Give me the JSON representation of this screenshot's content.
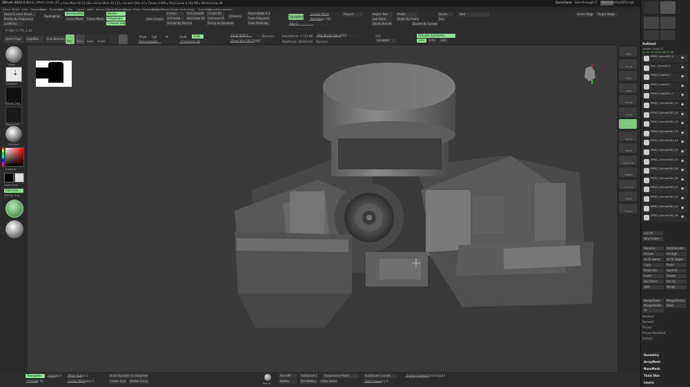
{
  "app": {
    "title": "ZBrush 2022.0.1",
    "file": "Ionic_Mech_tools_02",
    "stats": "▸ Free Mem 92.23 GB ▸ Active Mem 20.135 ▸ Scratch Disk 47 ▸ Timer▸ 0.009 ▸ PolyCount▸ 6.742 MP ▸ MeshCount▸ 48",
    "quicksave": "QuickSave",
    "see_through": "See-through 0",
    "menus_label": "Menus",
    "script": "DefaultZScript"
  },
  "menu": [
    "Alpha",
    "Brush",
    "Color",
    "Document",
    "Draw",
    "Dynamics",
    "Edit",
    "File",
    "Layer",
    "Light",
    "Macro",
    "Marker",
    "Material",
    "Movie",
    "Picker",
    "Preferences",
    "Render",
    "Stencil",
    "Stroke",
    "Texture",
    "Tool",
    "Transform",
    "Zplugin",
    "Zscript",
    "Help"
  ],
  "toptool": {
    "reset": "Reset Current Brush",
    "draft": "Draft By Floor",
    "modify": "Modify By Frequency 6",
    "list": "ListMirror",
    "topological": "Topological",
    "gizmo_mode": "Gizmo Mode",
    "backfacemask": "BackfaceMask",
    "curve_mode": "Curve Mode",
    "frame_mesh": "Frame Mesh",
    "border": "Border",
    "polygroups": "Polygroups",
    "creased_edges": "Creased edges",
    "crease": "Crease",
    "uncrease": "UnCrease",
    "uncrease_all": "UnCreaseAll",
    "crease_pg": "Crease PG",
    "uncrease_pg": "UnCrease PG",
    "groups_normals": "Groups By Normals",
    "create_pg": "Create PG",
    "crease_lvl": "Crease Lvl",
    "auto_groups": "Auto Groups",
    "group": "Group",
    "merge_groups": "Merge Groups",
    "group_split": "Group As Dynamesh Sub",
    "from_polypaint": "From Polypaint",
    "from_masking": "From Masking",
    "resolution": "Resol Width 0.32",
    "dynamesh": "DynaMesh",
    "groups_polish": "Groups  Polish",
    "project": "Project",
    "resolution2": "Resolution 256",
    "blur": "Blur 2",
    "smooth": "Higher Res",
    "sub_ratio": "Sub Ratio",
    "polish": "Polish",
    "polish_by_features": "Polish By Features",
    "shrink": "Shrink Prot Mirror",
    "double": "Double By Symmetry",
    "divide": "Divide",
    "smt": "Smt",
    "suv": "Suv",
    "rgb": "Rgb",
    "size": "Size",
    "home": "Home Stage",
    "target": "Target Stage",
    "coords": "0.7847,0.776,-1.2X",
    "home_page": "Home Page",
    "lightbox": "LightBox",
    "live_boolean": "Live Boolean",
    "edit": "Edit",
    "move": "Move",
    "scale": "Scale",
    "rotate": "Rotate",
    "mrgb": "Mrgb",
    "rgb2": "Rgb",
    "m": "M",
    "zadd": "Zadd",
    "zsub": "Zsub",
    "z_intensity": "Z Intensity 40",
    "rgb_intensity": "Rgb Intensity",
    "focal_shift": "Focal Shift 0",
    "draw_size": "Draw Size 102.21887",
    "dynamic": "Dynamic",
    "active_points": "ActivePoints: 4.723 Mil",
    "total_points": "TotalPoints: 18.943 Mil",
    "max_size": "Max Brush Size 4403",
    "dynamic2": "Dynamic",
    "xyz": "XYZ",
    "constant": "Constant",
    "activate_symmetry": "Activate Symmetry",
    "x": ">X<",
    "y": ">Y<",
    "z": ">Z<"
  },
  "left": {
    "alpha": "Alpha Off",
    "texture": "Texture Off",
    "material": "MatCap Gray",
    "gradient": "Gradient",
    "switch_color": "SwitchColor",
    "alternate": "Alternate",
    "brush": "Move",
    "stroke": "DragRect",
    "tool": "ZBrush_Ray",
    "color_label": "FillObject"
  },
  "right_shelf": [
    "Best",
    "Persp",
    "Floor",
    "Local",
    "Transp",
    "Ghost",
    "Solo",
    "Xpose",
    "Move",
    "Zoom3D",
    "Rotate",
    "Line Fill",
    "PolyF",
    "Frame"
  ],
  "tray": {
    "header_tools": [
      "PM3D_Cylinder3D",
      "FillObject",
      "SimpleBrush",
      "EraserBrush",
      "PM3D_Cyl...",
      "ZSphere",
      "Bananas"
    ],
    "subtool_title": "Subtool",
    "poly_count": "Visible Count 27",
    "count_row": "V1 V2 V3 V4 V5 V6 V7 V8",
    "subtools": [
      "PM3D_Sphere3D_1",
      "Ionic_Sphere3_0",
      "PM3D_Cube3D_1",
      "PM3D_Cube3D_2",
      "PM3D_Cube3D1_3",
      "PM3D_Cylinder3D1_11",
      "PM3D_Cylinder3D1_14",
      "PM3D_Cylinder3D1_13",
      "PM3D_Cylinder3D1_15",
      "PM3D_Cylinder3D1_24",
      "PM3D_Cylinder3D1_21",
      "PM3D_Cylinder3D1_22",
      "PM3D_Cylinder3D1_26",
      "PM3D_Cylinder3D1_30",
      "PM3D_Cylinder3D1_27",
      "PM3D_Cylinder3D1_32",
      "PM3D_Cylinder3D1_31",
      "PM3D_Cylinder3D1_34"
    ],
    "list_all": "List All",
    "new_folder": "New Folder",
    "actions": [
      "Rename",
      "AutoReorder",
      "All Low",
      "All High",
      "All To Home",
      "All To Target",
      "Copy",
      "Paste",
      "Duplicate",
      "Append",
      "Insert",
      "Delete",
      "Del Other",
      "Del All",
      "Split",
      "Merge"
    ],
    "merge_items": [
      "MergeDown",
      "MergeSimilar",
      "MergeVisible",
      "Weld",
      "Uv"
    ],
    "sections": [
      "Boolean",
      "Remesh",
      "Project",
      "Project BasRelief",
      "Extract"
    ],
    "bottom_sections": [
      "Geometry",
      "ArrayMesh",
      "NanoMesh",
      "Thick Skin",
      "Layers"
    ]
  },
  "bottom": {
    "transpose": "Transpose",
    "opacity": "Opacity 4",
    "intensity": "Intensity 40",
    "mask_radius": "Mask Radius 1",
    "radius_mult": "Radius Multiplier 2",
    "scale_dyna": "Scale Dynamic to Snapshot",
    "create_curve": "Create Curve",
    "delete_curve": "Delete Curve",
    "morph": "Morph",
    "switch": "StoreMT",
    "deltas": "Deltas",
    "del_hidden": "Del Hidden",
    "close_holes": "Close Holes",
    "sub_polish": "Frequencies Polish",
    "subdiv": "SubDivide Counter",
    "smt_count": "Smt Frequency 6",
    "backface_check": "Fractal Subtool Checking 6 PI"
  }
}
